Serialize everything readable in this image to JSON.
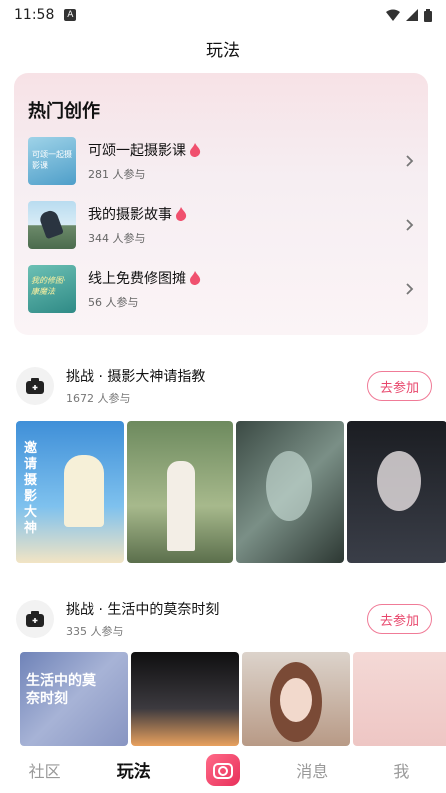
{
  "status_bar": {
    "time": "11:58"
  },
  "header": {
    "title": "玩法"
  },
  "hot": {
    "title": "热门创作",
    "items": [
      {
        "name": "可颂一起摄影课",
        "count": "281 人参与",
        "thumb_text": "可颂一起摄影课"
      },
      {
        "name": "我的摄影故事",
        "count": "344 人参与"
      },
      {
        "name": "线上免费修图摊",
        "count": "56 人参与",
        "thumb_text": "我的修图·康魔法"
      }
    ]
  },
  "challenges": [
    {
      "title": "挑战 · 摄影大神请指教",
      "count": "1672 人参与",
      "button": "去参加",
      "poster_text": "邀请摄影大神"
    },
    {
      "title": "挑战 · 生活中的莫奈时刻",
      "count": "335 人参与",
      "button": "去参加",
      "poster_text": "生活中的莫奈时刻"
    }
  ],
  "tabs": {
    "community": "社区",
    "play": "玩法",
    "messages": "消息",
    "me": "我"
  },
  "colors": {
    "accent": "#e8476c",
    "card_bg": "#f7e2e6"
  }
}
